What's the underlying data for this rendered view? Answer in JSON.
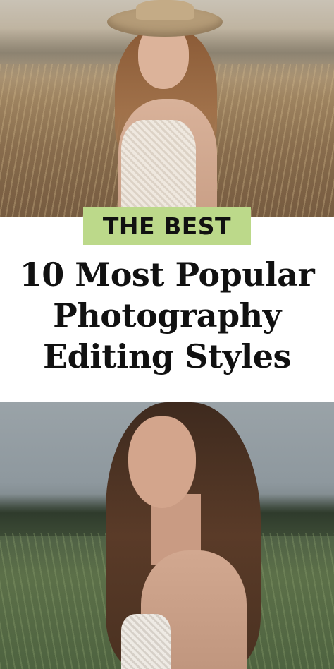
{
  "tag": {
    "label": "THE BEST"
  },
  "headline": {
    "lines": [
      "10 Most Popular",
      "Photography",
      "Editing Styles"
    ]
  },
  "colors": {
    "tag_background": "#bcd98a",
    "headline_text": "#111111",
    "background": "#ffffff"
  },
  "images": {
    "top": "photo-woman-hat-dry-grass-field",
    "bottom": "photo-woman-wavy-hair-green-field"
  }
}
